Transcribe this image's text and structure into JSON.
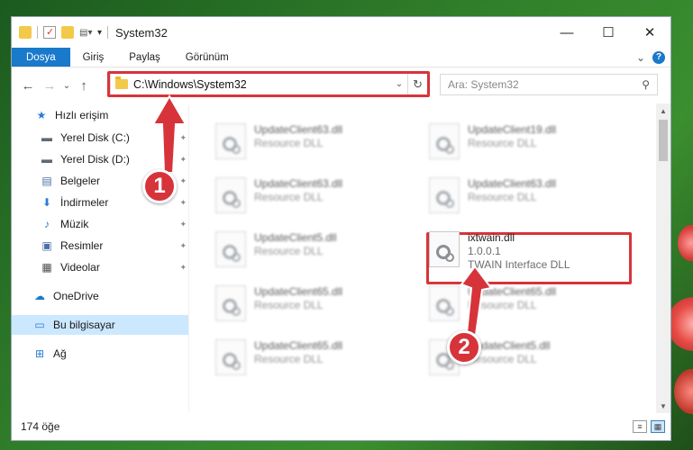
{
  "window": {
    "title": "System32",
    "controls": {
      "minimize": "—",
      "maximize": "☐",
      "close": "✕"
    }
  },
  "ribbon": {
    "tabs": [
      "Dosya",
      "Giriş",
      "Paylaş",
      "Görünüm"
    ],
    "expand_icon": "⌄",
    "help_icon": "?"
  },
  "nav": {
    "back": "←",
    "forward": "→",
    "recent": "⌄",
    "up": "↑",
    "address": "C:\\Windows\\System32",
    "address_dropdown": "⌄",
    "refresh": "↻",
    "search_placeholder": "Ara: System32",
    "search_icon": "⚲"
  },
  "sidebar": {
    "items": [
      {
        "label": "Hızlı erişim",
        "icon": "star-icon",
        "glyph": "★",
        "color": "#2a7bd4"
      },
      {
        "label": "Yerel Disk (C:)",
        "icon": "drive-icon",
        "glyph": "▬",
        "color": "#606a73",
        "pinned": true
      },
      {
        "label": "Yerel Disk (D:)",
        "icon": "drive-icon",
        "glyph": "▬",
        "color": "#606a73",
        "pinned": true
      },
      {
        "label": "Belgeler",
        "icon": "documents-icon",
        "glyph": "▤",
        "color": "#4a6fa5",
        "pinned": true
      },
      {
        "label": "İndirmeler",
        "icon": "download-icon",
        "glyph": "⬇",
        "color": "#2a7bd4",
        "pinned": true
      },
      {
        "label": "Müzik",
        "icon": "music-icon",
        "glyph": "♪",
        "color": "#2a7bd4",
        "pinned": true
      },
      {
        "label": "Resimler",
        "icon": "pictures-icon",
        "glyph": "▣",
        "color": "#4a6fa5",
        "pinned": true
      },
      {
        "label": "Videolar",
        "icon": "videos-icon",
        "glyph": "▦",
        "color": "#4a4a4a",
        "pinned": true
      },
      {
        "label": "OneDrive",
        "icon": "cloud-icon",
        "glyph": "☁",
        "color": "#1979ca"
      },
      {
        "label": "Bu bilgisayar",
        "icon": "computer-icon",
        "glyph": "▭",
        "color": "#2a7bd4",
        "selected": true
      },
      {
        "label": "Ağ",
        "icon": "network-icon",
        "glyph": "⊞",
        "color": "#2a7bd4"
      }
    ],
    "pin_glyph": "📌"
  },
  "files": [
    {
      "name": "UpdateClient63.dll",
      "meta1": "Resource DLL",
      "blurred": true
    },
    {
      "name": "UpdateClient19.dll",
      "meta1": "Resource DLL",
      "blurred": true
    },
    {
      "name": "UpdateClient63.dll",
      "meta1": "Resource DLL",
      "blurred": true
    },
    {
      "name": "UpdateClient63.dll",
      "meta1": "Resource DLL",
      "blurred": true
    },
    {
      "name": "UpdateClient5.dll",
      "meta1": "Resource DLL",
      "blurred": true
    },
    {
      "name": "ixtwain.dll",
      "meta1": "1.0.0.1",
      "meta2": "TWAIN Interface DLL",
      "blurred": false
    },
    {
      "name": "UpdateClient65.dll",
      "meta1": "Resource DLL",
      "blurred": true
    },
    {
      "name": "UpdateClient65.dll",
      "meta1": "Resource DLL",
      "blurred": true
    },
    {
      "name": "UpdateClient65.dll",
      "meta1": "Resource DLL",
      "blurred": true
    },
    {
      "name": "UpdateClient5.dll",
      "meta1": "Resource DLL",
      "blurred": true
    }
  ],
  "status": {
    "item_count": "174 öğe",
    "view_details": "≡",
    "view_tiles": "▦"
  },
  "callouts": [
    "1",
    "2"
  ],
  "scroll": {
    "up": "▲",
    "down": "▼"
  },
  "colors": {
    "accent": "#1979ca",
    "highlight": "#d6343a",
    "selected": "#cce8ff"
  }
}
